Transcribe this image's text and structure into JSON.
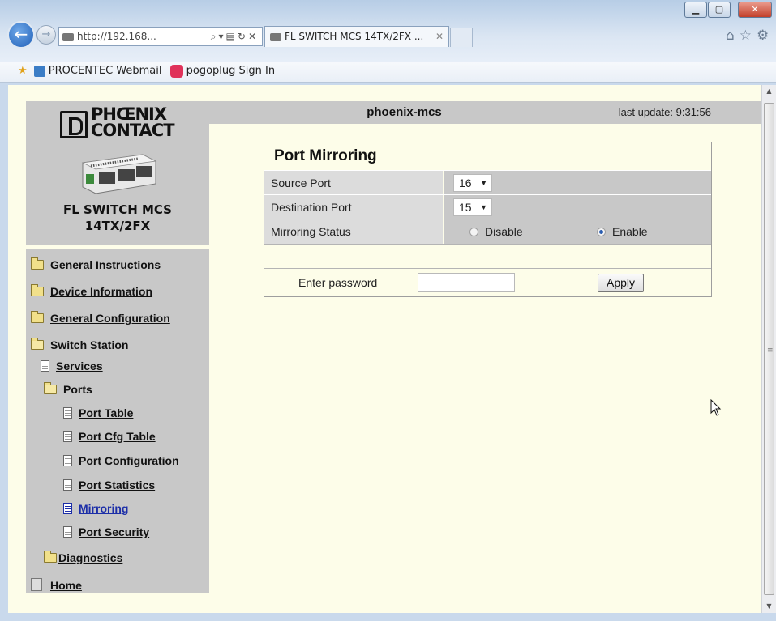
{
  "browser": {
    "address": "http://192.168...",
    "tab_title": "FL SWITCH MCS 14TX/2FX ...",
    "favorites": [
      "PROCENTEC Webmail",
      "pogoplug Sign In"
    ]
  },
  "sidebar": {
    "logo_line1": "PHŒNIX",
    "logo_line2": "CONTACT",
    "device_name_line1": "FL SWITCH MCS",
    "device_name_line2": "14TX/2FX",
    "nav": {
      "general_instructions": "General Instructions",
      "device_information": "Device Information",
      "general_configuration": "General Configuration",
      "switch_station": "Switch Station",
      "services": "Services",
      "ports": "Ports",
      "port_table": "Port Table",
      "port_cfg_table": "Port Cfg Table",
      "port_configuration": "Port Configuration",
      "port_statistics": "Port Statistics",
      "mirroring": "Mirroring",
      "port_security": "Port Security",
      "diagnostics": "Diagnostics",
      "home": "Home"
    }
  },
  "header": {
    "device": "phoenix-mcs",
    "last_update": "last update: 9:31:56"
  },
  "mirroring": {
    "title": "Port Mirroring",
    "source_label": "Source Port",
    "source_value": "16",
    "destination_label": "Destination Port",
    "destination_value": "15",
    "status_label": "Mirroring Status",
    "disable_label": "Disable",
    "enable_label": "Enable",
    "status_selected": "Enable",
    "password_label": "Enter password",
    "apply_label": "Apply"
  },
  "colors": {
    "page_bg": "#fdfde9",
    "panel_gray": "#c8c8c8",
    "label_gray": "#dcdcdc",
    "active_link": "#1c2ea8"
  }
}
